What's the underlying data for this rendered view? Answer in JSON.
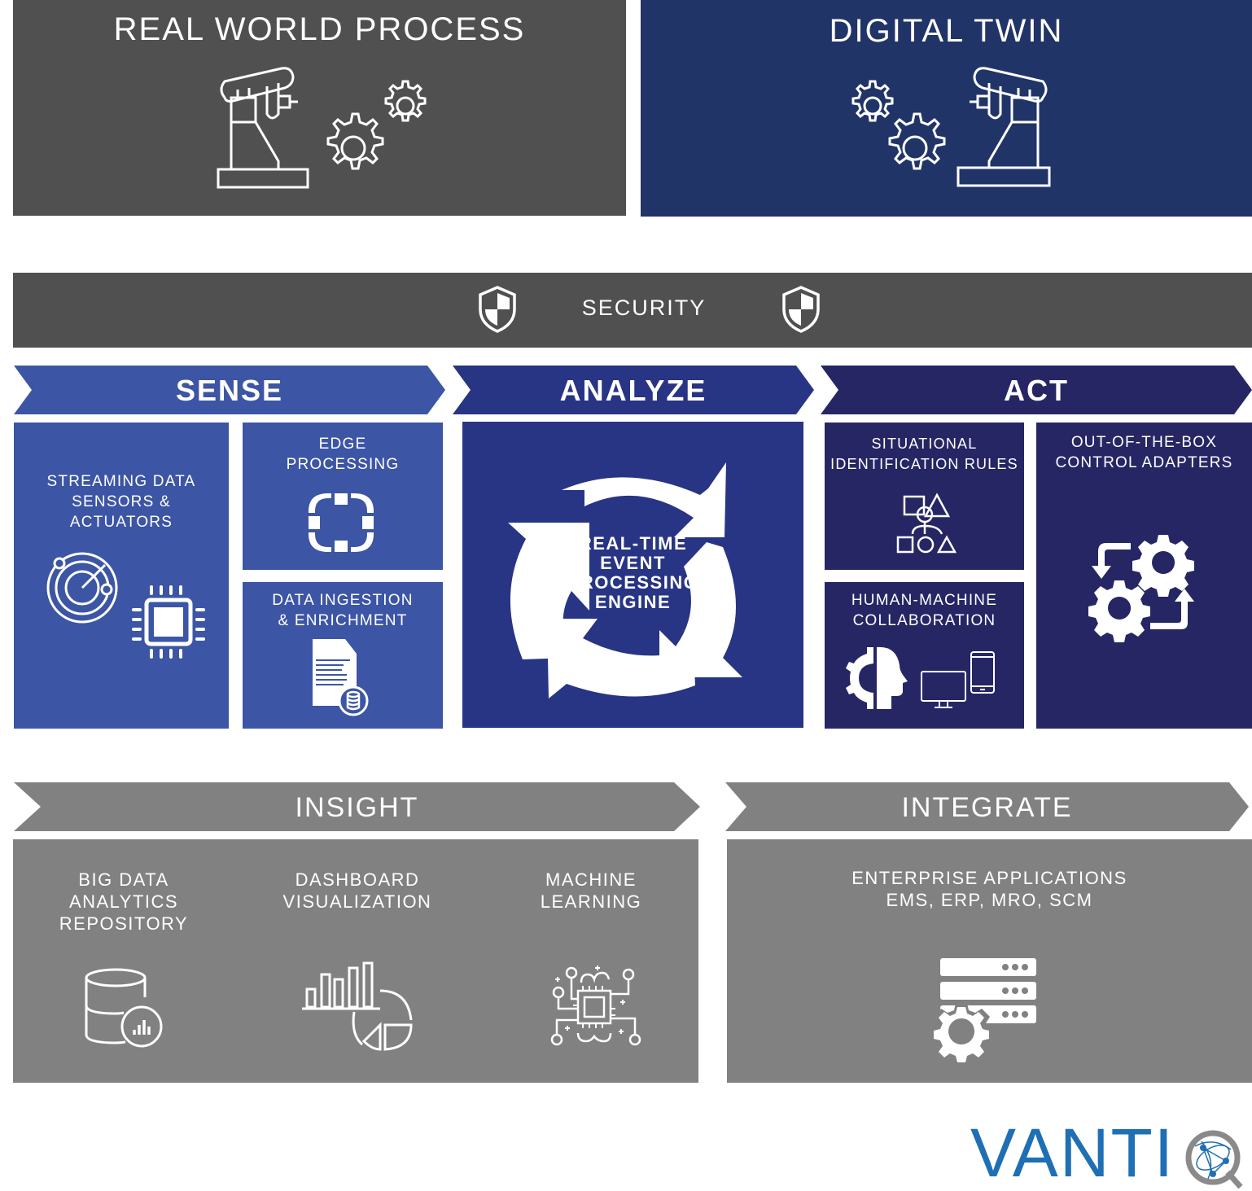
{
  "top": {
    "real_world": {
      "title": "REAL WORLD PROCESS",
      "icon": "robot-arm-gears-icon"
    },
    "digital_twin": {
      "title": "DIGITAL TWIN",
      "icon": "gears-robot-arm-icon"
    }
  },
  "security": {
    "label": "SECURITY",
    "icon": "shield-icon"
  },
  "stages": {
    "sense": {
      "label": "SENSE",
      "tiles": [
        {
          "label_lines": [
            "STREAMING DATA",
            "SENSORS &",
            "ACTUATORS"
          ],
          "icons": [
            "radar-icon",
            "chip-icon"
          ]
        },
        {
          "label_lines": [
            "EDGE",
            "PROCESSING"
          ],
          "icon": "edge-frame-icon"
        },
        {
          "label_lines": [
            "DATA INGESTION",
            "& ENRICHMENT"
          ],
          "icon": "document-database-icon"
        }
      ]
    },
    "analyze": {
      "label": "ANALYZE",
      "tiles": [
        {
          "label_lines": [
            "REAL-TIME",
            "EVENT",
            "PROCESSING",
            "ENGINE"
          ],
          "icon": "cycle-arrows-icon"
        }
      ]
    },
    "act": {
      "label": "ACT",
      "tiles": [
        {
          "label_lines": [
            "SITUATIONAL",
            "IDENTIFICATION RULES"
          ],
          "icon": "shapes-hierarchy-icon"
        },
        {
          "label_lines": [
            "HUMAN-MACHINE",
            "COLLABORATION"
          ],
          "icons": [
            "gear-head-icon",
            "monitor-icon",
            "smartphone-icon"
          ]
        },
        {
          "label_lines": [
            "OUT-OF-THE-BOX",
            "CONTROL ADAPTERS"
          ],
          "icon": "gears-arrows-icon"
        }
      ]
    }
  },
  "insight": {
    "label": "INSIGHT",
    "items": [
      {
        "label_lines": [
          "BIG DATA",
          "ANALYTICS",
          "REPOSITORY"
        ],
        "icon": "database-chart-icon"
      },
      {
        "label_lines": [
          "DASHBOARD",
          "VISUALIZATION"
        ],
        "icon": "bar-pie-chart-icon"
      },
      {
        "label_lines": [
          "MACHINE",
          "LEARNING"
        ],
        "icon": "ai-chip-icon"
      }
    ]
  },
  "integrate": {
    "label": "INTEGRATE",
    "items": [
      {
        "label_lines": [
          "ENTERPRISE APPLICATIONS",
          "EMS, ERP, MRO, SCM"
        ],
        "icon": "server-gear-icon"
      }
    ]
  },
  "logo": {
    "text_blue": "VANTI",
    "text_gray": "Q",
    "colors": {
      "blue": "#1f6fb5",
      "gray": "#8a8a8a"
    }
  },
  "colors": {
    "gray_dark": "#505050",
    "navy": "#213468",
    "sense": "#3c55a5",
    "analyze": "#283484",
    "act": "#262665",
    "gray": "#808180"
  }
}
